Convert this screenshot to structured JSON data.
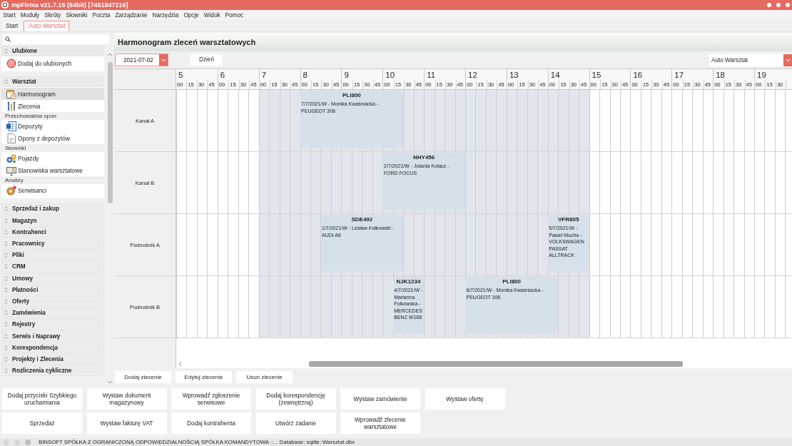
{
  "window": {
    "title": "mpFirma v21.7.15 (64bit) [7451847216]"
  },
  "menu": [
    "Start",
    "Moduły",
    "Skróty",
    "Słowniki",
    "Poczta",
    "Zarządzanie",
    "Narzędzia",
    "Opcje",
    "Widok",
    "Pomoc"
  ],
  "tabs": [
    {
      "label": "Start",
      "selected": false
    },
    {
      "label": ":Auto Warsztat",
      "selected": true
    }
  ],
  "sidebar": {
    "sections": [
      {
        "title": "Ulubione",
        "expanded": true,
        "items": [
          {
            "kind": "link",
            "label": "Dodaj do ulubionych",
            "selected": false
          }
        ]
      },
      {
        "title": "Warsztat",
        "expanded": true,
        "items": [
          {
            "kind": "link",
            "label": "Harmonogram",
            "selected": true
          },
          {
            "kind": "link",
            "label": "Zlecenia",
            "selected": false
          },
          {
            "kind": "group",
            "label": "Przechowalnia opon"
          },
          {
            "kind": "link",
            "label": "Depozyty",
            "selected": false
          },
          {
            "kind": "link",
            "label": "Opony z depozytów",
            "selected": false
          },
          {
            "kind": "group",
            "label": "Słowniki"
          },
          {
            "kind": "link",
            "label": "Pojazdy",
            "selected": false
          },
          {
            "kind": "link",
            "label": "Stanowiska warsztatowe",
            "selected": false
          },
          {
            "kind": "group",
            "label": "Analizy"
          },
          {
            "kind": "link",
            "label": "Serwisanci",
            "selected": false
          }
        ]
      },
      {
        "title": "Sprzedaż i zakup",
        "expanded": false
      },
      {
        "title": "Magazyn",
        "expanded": false
      },
      {
        "title": "Kontrahenci",
        "expanded": false
      },
      {
        "title": "Pracownicy",
        "expanded": false
      },
      {
        "title": "Pliki",
        "expanded": false
      },
      {
        "title": "CRM",
        "expanded": false
      },
      {
        "title": "Umowy",
        "expanded": false
      },
      {
        "title": "Płatności",
        "expanded": false
      },
      {
        "title": "Oferty",
        "expanded": false
      },
      {
        "title": "Zamówienia",
        "expanded": false
      },
      {
        "title": "Rejestry",
        "expanded": false
      },
      {
        "title": "Serwis i Naprawy",
        "expanded": false
      },
      {
        "title": "Korespondencja",
        "expanded": false
      },
      {
        "title": "Projekty i Zlecenia",
        "expanded": false
      },
      {
        "title": "Rozliczenia cykliczne",
        "expanded": false
      }
    ]
  },
  "schedule": {
    "title": "Harmonogram zleceń warsztatowych",
    "date": {
      "value": "2021-07-02"
    },
    "view_button": "Dzień",
    "workshop": {
      "value": "Auto Warsztat"
    },
    "hours": [
      {
        "label": "5",
        "minutes": [
          "00",
          "15",
          "30",
          "45"
        ],
        "working": false
      },
      {
        "label": "6",
        "minutes": [
          "00",
          "15",
          "30",
          "45"
        ],
        "working": false
      },
      {
        "label": "7",
        "minutes": [
          "00",
          "15",
          "30",
          "45"
        ],
        "working": true
      },
      {
        "label": "8",
        "minutes": [
          "00",
          "15",
          "30",
          "45"
        ],
        "working": true
      },
      {
        "label": "9",
        "minutes": [
          "00",
          "15",
          "30",
          "45"
        ],
        "working": true
      },
      {
        "label": "10",
        "minutes": [
          "00",
          "15",
          "30",
          "45"
        ],
        "working": true
      },
      {
        "label": "11",
        "minutes": [
          "00",
          "15",
          "30",
          "45"
        ],
        "working": true
      },
      {
        "label": "12",
        "minutes": [
          "00",
          "15",
          "30",
          "45"
        ],
        "working": true
      },
      {
        "label": "13",
        "minutes": [
          "00",
          "15",
          "30",
          "45"
        ],
        "working": true
      },
      {
        "label": "14",
        "minutes": [
          "00",
          "15",
          "30",
          "45"
        ],
        "working": true
      },
      {
        "label": "15",
        "minutes": [
          "00",
          "15",
          "30",
          "45"
        ],
        "working": false
      },
      {
        "label": "16",
        "minutes": [
          "00",
          "15",
          "30",
          "45"
        ],
        "working": false
      },
      {
        "label": "17",
        "minutes": [
          "00",
          "15",
          "30",
          "45"
        ],
        "working": false
      },
      {
        "label": "18",
        "minutes": [
          "00",
          "15",
          "30",
          "45"
        ],
        "working": false
      },
      {
        "label": "19",
        "minutes": [
          "00",
          "15",
          "30"
        ],
        "working": false
      }
    ],
    "rows": [
      {
        "label": "Kanał A",
        "events": [
          {
            "title": "PLI800",
            "description": "7/7/2021/W - Monika Kwaśniacka - PEUGEOT 308"
          }
        ]
      },
      {
        "label": "Kanał B",
        "events": [
          {
            "title": "NHY456",
            "description": "2/7/2021/W - Jolanta Kołacz - FORD FOCUS"
          }
        ]
      },
      {
        "label": "Podnośnik A",
        "events": [
          {
            "title": "SDE492",
            "description": "1/7/2021/W - Lesław Kołkowski - AUDI A6"
          },
          {
            "title": "VFR805",
            "description": "5/7/2021/W - Paweł Mucha - VOLKSWAGEN PASSAT ALLTRACK"
          }
        ]
      },
      {
        "label": "Podnośnik B",
        "events": [
          {
            "title": "NJK1234",
            "description": "4/7/2021/W - Marianna Folkowska - MERCEDES BENZ W168"
          },
          {
            "title": "PLI800",
            "description": "6/7/2021/W - Monika Kwaśniacka - PEUGEOT 308"
          }
        ]
      }
    ],
    "actions": [
      "Dodaj zlecenie",
      "Edytuj zlecenie",
      "Usuń zlecenie"
    ]
  },
  "quick_actions": [
    "Dodaj przyciski Szybkiego uruchamiania",
    "Wystaw dokument magazynowy",
    "Wprowadź zgłoszenie serwisowe",
    "Dodaj korespondencję (zewnętrzną)",
    "Wystaw zamówienie",
    "Wystaw ofertę",
    "Sprzedaż",
    "Wystaw fakturę VAT",
    "Dodaj kontrahenta",
    "Utwórz zadanie",
    "Wprowadź zlecenie warsztatowe"
  ],
  "status_bar": {
    "text": "BINSOFT SPÓŁKA Z OGRANICZONĄ ODPOWIEDZIALNOŚCIĄ SPÓŁKA KOMANDYTOWA ::... Database: sqlite::Warsztat.dbx"
  }
}
